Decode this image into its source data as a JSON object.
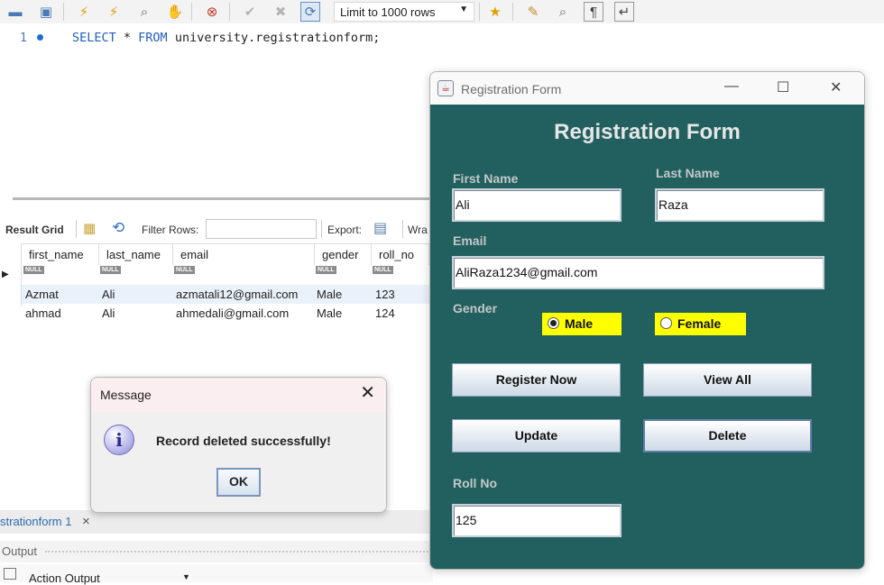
{
  "toolbar": {
    "limit_label": "Limit to 1000 rows",
    "icons": [
      "open-folder-icon",
      "save-icon",
      "execute-icon",
      "execute-current-icon",
      "explain-icon",
      "stop-icon",
      "toggle-error-icon",
      "commit-icon",
      "rollback-icon",
      "autocommit-icon",
      "bookmark-star-icon",
      "beautify-icon",
      "find-icon",
      "invisible-chars-icon",
      "wrap-icon"
    ]
  },
  "editor": {
    "line_number": "1",
    "sql_keyword_select": "SELECT",
    "sql_star": " * ",
    "sql_keyword_from": "FROM",
    "sql_target": " university.registrationform;"
  },
  "result_grid": {
    "label": "Result Grid",
    "filter_label": "Filter Rows:",
    "filter_value": "",
    "export_label": "Export:",
    "wrap_label": "Wra",
    "columns": [
      "first_name",
      "last_name",
      "email",
      "gender",
      "roll_no"
    ],
    "null_badge": "NULL",
    "rows": [
      [
        "Azmat",
        "Ali",
        "azmatali12@gmail.com",
        "Male",
        "123"
      ],
      [
        "ahmad",
        "Ali",
        "ahmedali@gmail.com",
        "Male",
        "124"
      ]
    ]
  },
  "bottom": {
    "tab_label": "strationform 1",
    "tab_close": "×",
    "output_label": "Output",
    "action_output_label": "Action Output"
  },
  "message_dialog": {
    "title": "Message",
    "close": "✕",
    "info_glyph": "i",
    "text": "Record deleted successfully!",
    "ok_label": "OK"
  },
  "registration": {
    "window_title": "Registration Form",
    "minimize": "—",
    "maximize": "☐",
    "close": "✕",
    "heading": "Registration Form",
    "first_name_label": "First Name",
    "first_name_value": "Ali",
    "last_name_label": "Last Name",
    "last_name_value": "Raza",
    "email_label": "Email",
    "email_value": "AliRaza1234@gmail.com",
    "gender_label": "Gender",
    "gender_options": [
      "Male",
      "Female"
    ],
    "gender_selected": "Male",
    "register_label": "Register Now",
    "view_all_label": "View All",
    "update_label": "Update",
    "delete_label": "Delete",
    "roll_no_label": "Roll No",
    "roll_no_value": "125",
    "accent_color": "#226060",
    "radio_bg": "#ffff00"
  }
}
